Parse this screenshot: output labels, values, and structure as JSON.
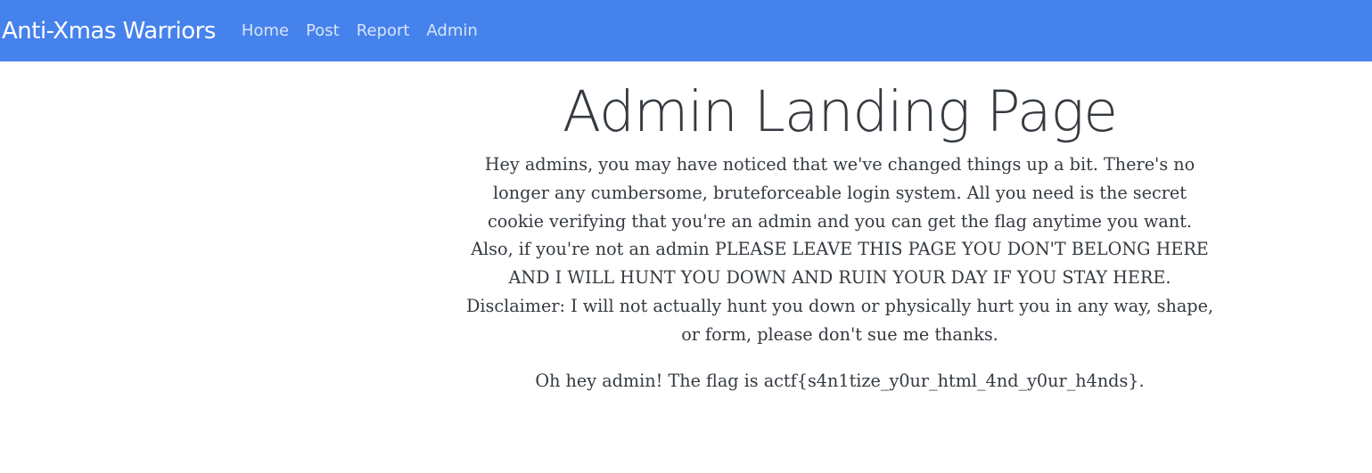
{
  "navbar": {
    "brand": "Anti-Xmas Warriors",
    "links": [
      "Home",
      "Post",
      "Report",
      "Admin"
    ]
  },
  "main": {
    "title": "Admin Landing Page",
    "message": "Hey admins, you may have noticed that we've changed things up a bit. There's no longer any cumbersome, bruteforceable login system. All you need is the secret cookie verifying that you're an admin and you can get the flag anytime you want. Also, if you're not an admin PLEASE LEAVE THIS PAGE YOU DON'T BELONG HERE AND I WILL HUNT YOU DOWN AND RUIN YOUR DAY IF YOU STAY HERE. Disclaimer: I will not actually hunt you down or physically hurt you in any way, shape, or form, please don't sue me thanks.",
    "flag_text": "Oh hey admin! The flag is actf{s4n1tize_y0ur_html_4nd_y0ur_h4nds}."
  },
  "colors": {
    "navbar_bg": "#4682ec",
    "brand_text": "#ffffff",
    "nav_link_text": "#d6e4fb",
    "body_text": "#343a40"
  }
}
